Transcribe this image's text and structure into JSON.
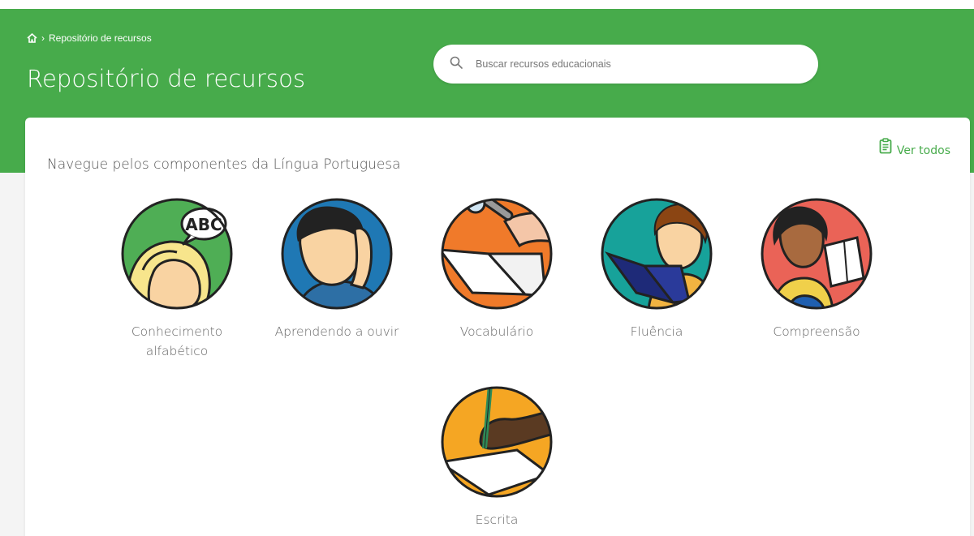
{
  "breadcrumb": {
    "current": "Repositório de recursos"
  },
  "header": {
    "title": "Repositório de recursos"
  },
  "search": {
    "placeholder": "Buscar recursos educacionais"
  },
  "section": {
    "title": "Navegue pelos componentes da Língua Portuguesa",
    "see_all": "Ver todos"
  },
  "components": [
    {
      "label": "Conhecimento alfabético",
      "icon": "abc-speech-child-icon",
      "color": "#4fae55"
    },
    {
      "label": "Aprendendo a ouvir",
      "icon": "listening-child-icon",
      "color": "#1f78b4"
    },
    {
      "label": "Vocabulário",
      "icon": "magnifier-book-icon",
      "color": "#f07a2a"
    },
    {
      "label": "Fluência",
      "icon": "reading-aloud-icon",
      "color": "#17a29a"
    },
    {
      "label": "Compreensão",
      "icon": "thinking-reader-icon",
      "color": "#ea6357"
    },
    {
      "label": "Escrita",
      "icon": "writing-hand-icon",
      "color": "#f5a623"
    }
  ],
  "colors": {
    "brand": "#47ab4b",
    "background": "#f4f4f4"
  }
}
